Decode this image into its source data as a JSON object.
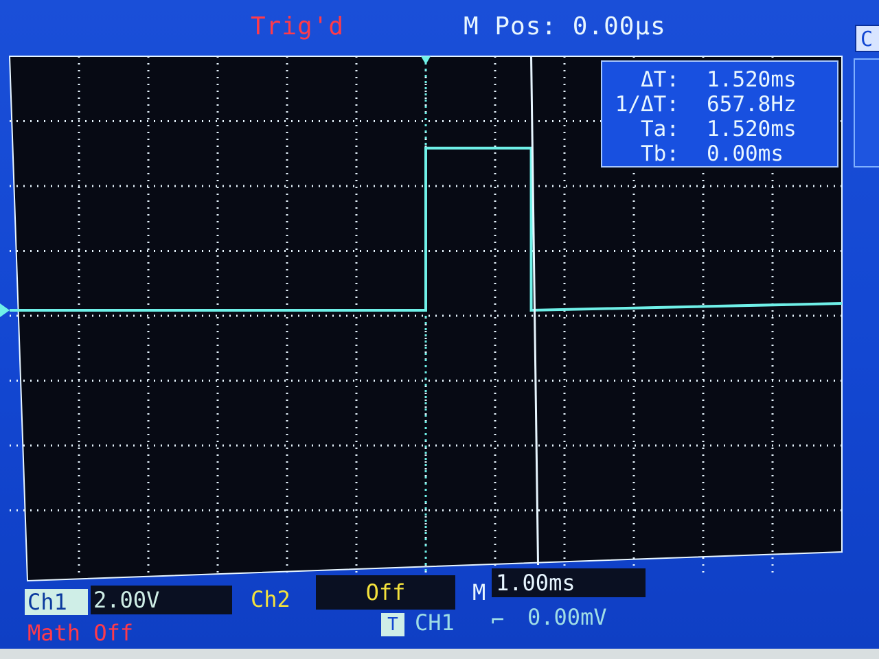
{
  "header": {
    "trigger_status": "Trig'd",
    "main_position": "M Pos: 0.00µs",
    "right_tab": "C"
  },
  "measurements": {
    "rows": [
      {
        "label": "ΔT:",
        "value": "1.520ms"
      },
      {
        "label": "1/ΔT:",
        "value": "657.8Hz"
      },
      {
        "label": "Ta:",
        "value": "1.520ms"
      },
      {
        "label": "Tb:",
        "value": "0.00ms"
      }
    ]
  },
  "footer": {
    "ch1_label": "Ch1",
    "ch1_scale": "2.00V",
    "ch2_label": "Ch2",
    "ch2_scale": "Off",
    "timebase_label": "M",
    "timebase_scale": "1.00ms",
    "math": "Math Off",
    "trigger_icon": "T",
    "trigger_source": "CH1",
    "trigger_slope_icon": "rising-edge-icon",
    "trigger_slope": "⌐",
    "trigger_level": "0.00mV"
  },
  "colors": {
    "screen_blue": "#1347d2",
    "trace_cyan": "#6ff0e8",
    "cursor_white": "#e8f6ff",
    "trig_red": "#ff3a4a",
    "ch2_yellow": "#f4e23c"
  },
  "waveform": {
    "time_per_div_ms": 1.0,
    "volts_per_div": 2.0,
    "pulse_start_div": 0.0,
    "pulse_end_div": 1.52,
    "pulse_amplitude_div": 2.5,
    "cursor_b_div": 0.0,
    "cursor_a_div": 1.52
  }
}
